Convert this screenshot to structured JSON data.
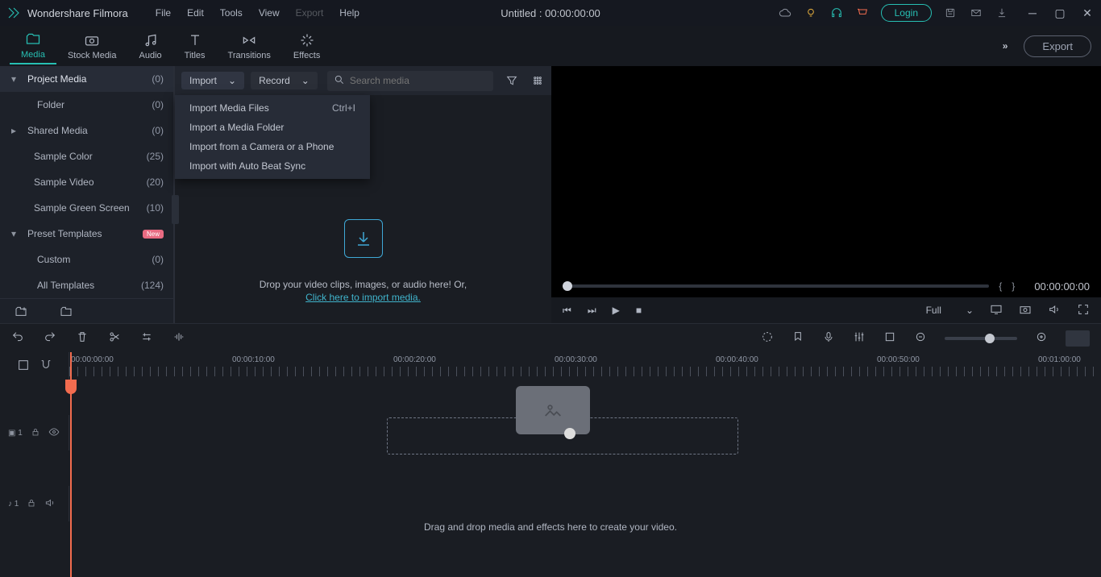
{
  "app": {
    "name": "Wondershare Filmora"
  },
  "menubar": [
    "File",
    "Edit",
    "Tools",
    "View",
    "Export",
    "Help"
  ],
  "menubar_disabled_index": 4,
  "doc_title": "Untitled : 00:00:00:00",
  "login_label": "Login",
  "tool_tabs": [
    {
      "label": "Media",
      "icon": "folder"
    },
    {
      "label": "Stock Media",
      "icon": "camera"
    },
    {
      "label": "Audio",
      "icon": "music"
    },
    {
      "label": "Titles",
      "icon": "text"
    },
    {
      "label": "Transitions",
      "icon": "flip"
    },
    {
      "label": "Effects",
      "icon": "sparkle"
    }
  ],
  "export_label": "Export",
  "sidebar": {
    "items": [
      {
        "label": "Project Media",
        "count": "(0)",
        "expandable": true,
        "selected": true
      },
      {
        "label": "Folder",
        "count": "(0)",
        "indent": 2
      },
      {
        "label": "Shared Media",
        "count": "(0)",
        "expandable": true
      },
      {
        "label": "Sample Color",
        "count": "(25)"
      },
      {
        "label": "Sample Video",
        "count": "(20)"
      },
      {
        "label": "Sample Green Screen",
        "count": "(10)"
      },
      {
        "label": "Preset Templates",
        "count": "",
        "expandable": true,
        "badge": "New"
      },
      {
        "label": "Custom",
        "count": "(0)",
        "indent": 2
      },
      {
        "label": "All Templates",
        "count": "(124)",
        "indent": 2
      }
    ]
  },
  "media_toolbar": {
    "import": "Import",
    "record": "Record",
    "search_placeholder": "Search media"
  },
  "import_menu": [
    {
      "label": "Import Media Files",
      "shortcut": "Ctrl+I"
    },
    {
      "label": "Import a Media Folder"
    },
    {
      "label": "Import from a Camera or a Phone"
    },
    {
      "label": "Import with Auto Beat Sync"
    }
  ],
  "dropzone": {
    "line1": "Drop your video clips, images, or audio here! Or,",
    "link": "Click here to import media."
  },
  "preview": {
    "timecode": "00:00:00:00",
    "fit": "Full"
  },
  "ruler_times": [
    "00:00:00:00",
    "00:00:10:00",
    "00:00:20:00",
    "00:00:30:00",
    "00:00:40:00",
    "00:00:50:00",
    "00:01:00:00"
  ],
  "timeline_hint": "Drag and drop media and effects here to create your video.",
  "tracks": {
    "video": "1",
    "audio": "1"
  }
}
